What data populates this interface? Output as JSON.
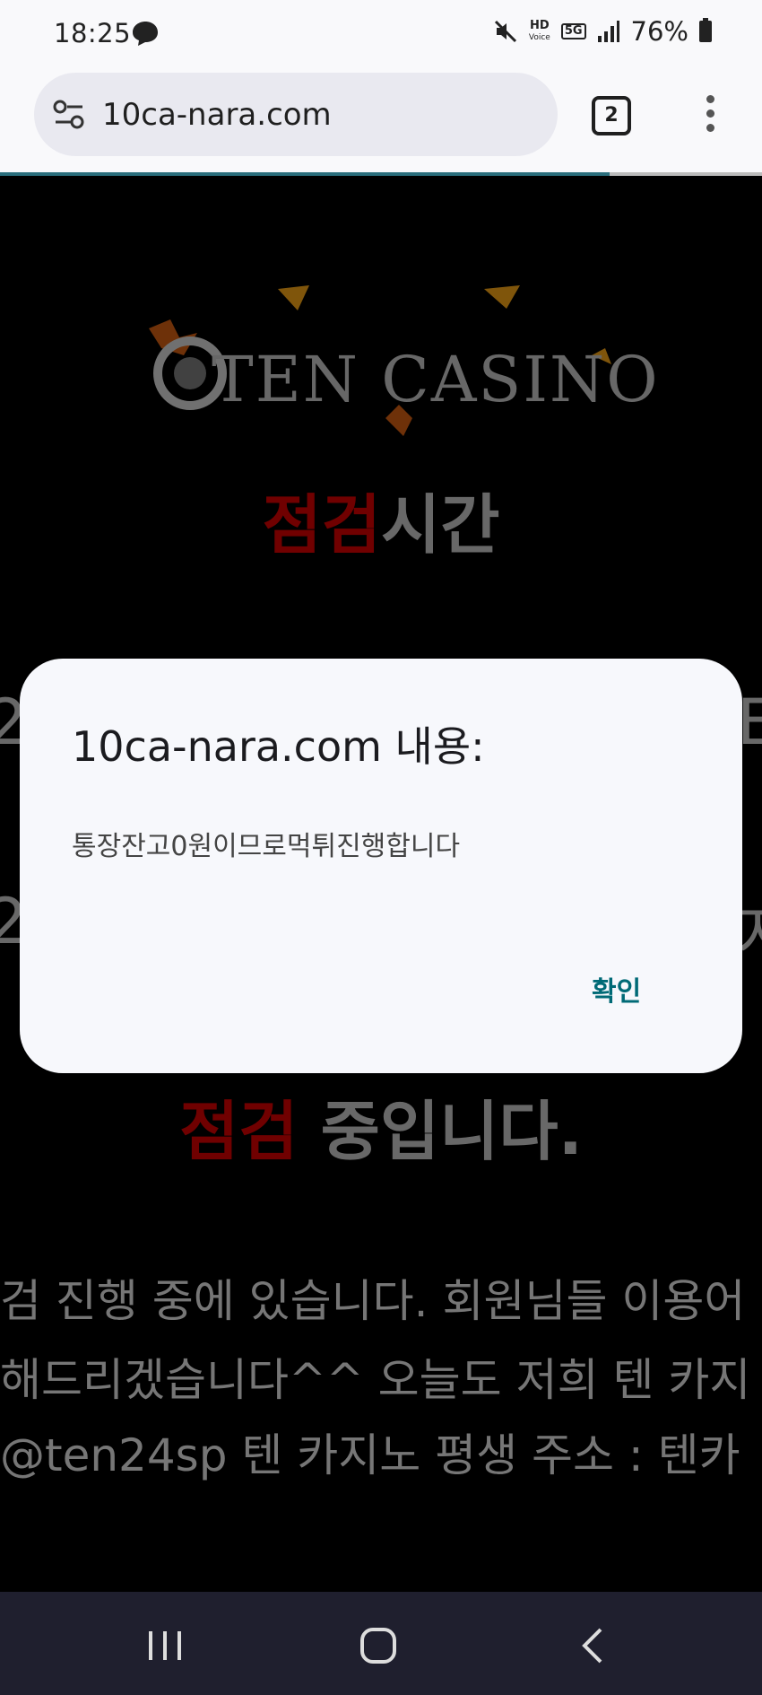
{
  "status_bar": {
    "time": "18:25",
    "hd_label": "HD",
    "voice_label": "Voice",
    "network_label": "5G",
    "battery_percent": "76%",
    "icons": [
      "chat-bubble-icon",
      "mute-icon",
      "hd-voice-icon",
      "5g-icon",
      "signal-icon",
      "battery-icon"
    ]
  },
  "browser": {
    "url": "10ca-nara.com",
    "tab_count": "2",
    "load_progress": 0.8
  },
  "page": {
    "logo_text": "TEN CASINO",
    "heading_red": "점검",
    "heading_rest": "시간",
    "heading2_red": "점검",
    "heading2_rest": " 중입니다.",
    "side_left_1": "2",
    "side_right_1": "E",
    "side_left_2": "2",
    "side_right_2": "지",
    "lines": [
      "검 진행 중에 있습니다. 회원님들 이용어",
      "해드리겠습니다^^ 오늘도 저희 텐 카지",
      "@ten24sp 텐 카지노 평생 주소 : 텐카"
    ]
  },
  "dialog": {
    "title": "10ca-nara.com 내용:",
    "message": "통장잔고0원이므로먹튀진행합니다",
    "ok_label": "확인"
  },
  "colors": {
    "accent": "#006a76",
    "red": "#cc0000",
    "navbar": "#1f1f2e"
  }
}
